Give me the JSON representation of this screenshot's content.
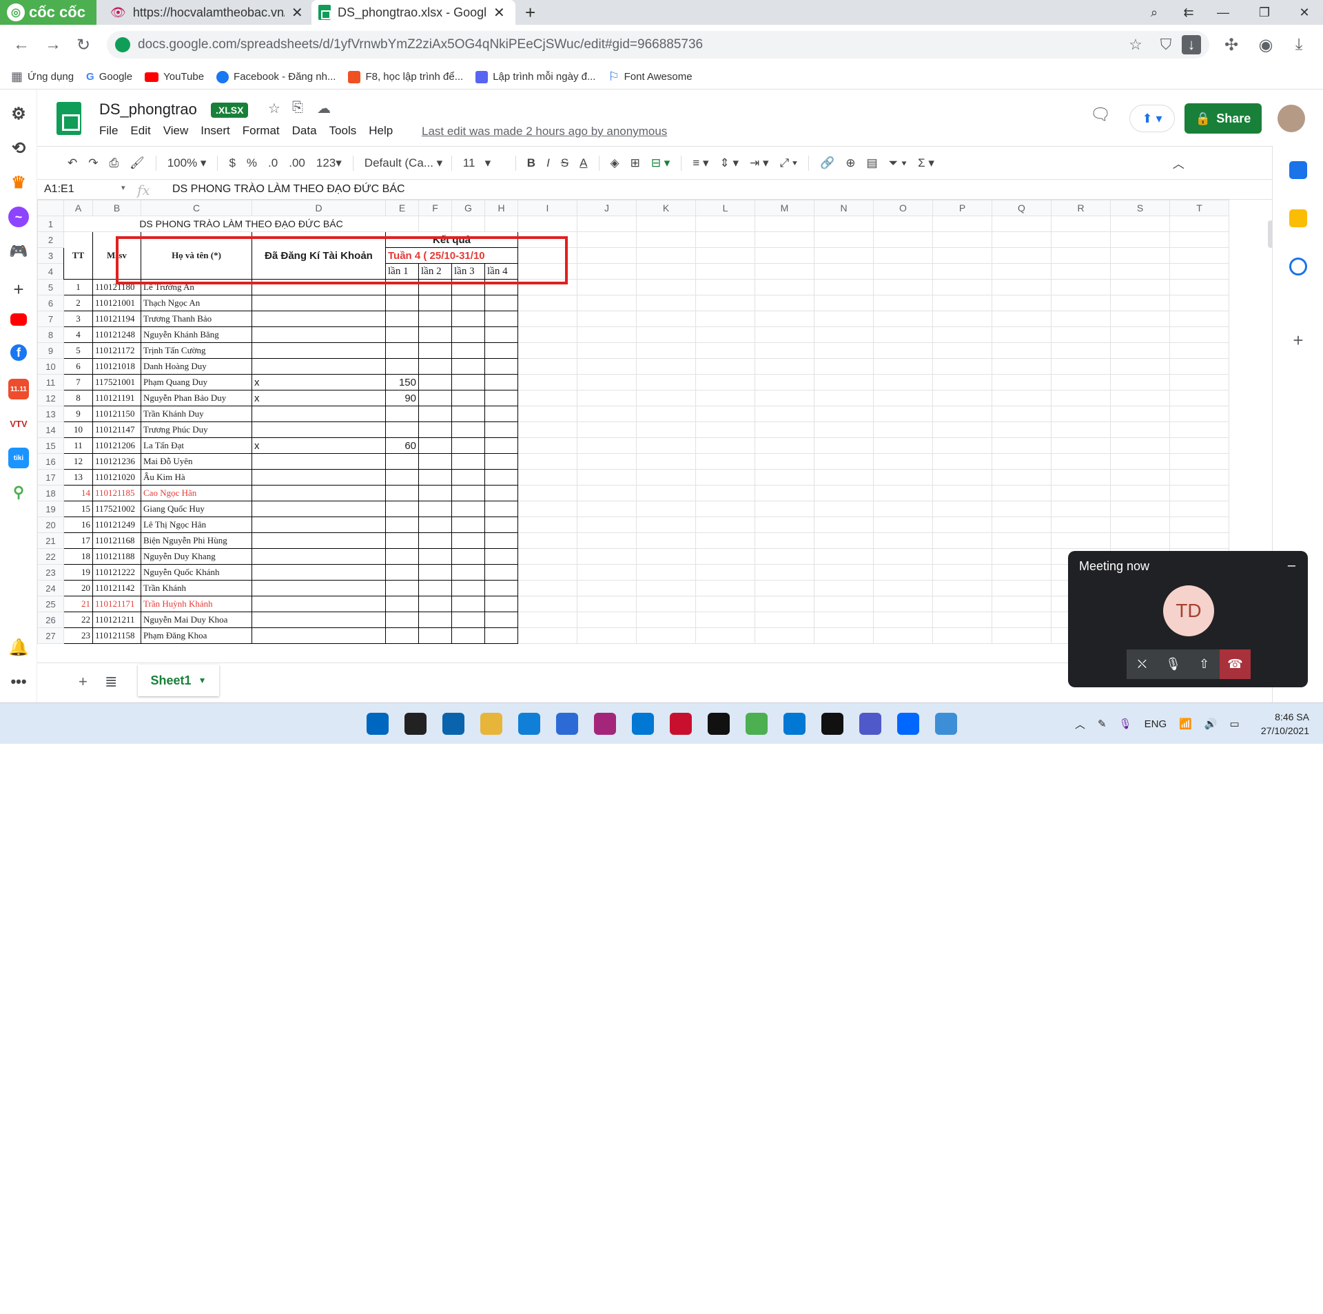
{
  "browser": {
    "brand": "cốc cốc",
    "tabs": [
      {
        "title": "https://hocvalamtheobac.vn/"
      },
      {
        "title": "DS_phongtrao.xlsx - Google S"
      }
    ],
    "url": "docs.google.com/spreadsheets/d/1yfVrnwbYmZ2ziAx5OG4qNkiPEeCjSWuc/edit#gid=966885736",
    "bookmarks": [
      "Ứng dụng",
      "Google",
      "YouTube",
      "Facebook - Đăng nh...",
      "F8, học lập trình để...",
      "Lập trình mỗi ngày đ...",
      "Font Awesome"
    ],
    "bookmark_colors": [
      "#5f6368",
      "#4285f4",
      "#ff0000",
      "#1877f2",
      "#f05123",
      "#5865f2",
      "#1a73e8"
    ]
  },
  "doc": {
    "title": "DS_phongtrao",
    "badge": ".XLSX",
    "menu": [
      "File",
      "Edit",
      "View",
      "Insert",
      "Format",
      "Data",
      "Tools",
      "Help"
    ],
    "last_edit": "Last edit was made 2 hours ago by anonymous",
    "share_label": "Share"
  },
  "toolbar": {
    "zoom": "100%",
    "currency": "$",
    "percent": "%",
    "dec_less": ".0",
    "dec_more": ".00",
    "format_more": "123",
    "font": "Default (Ca...",
    "font_size": "11"
  },
  "formula": {
    "namebox": "A1:E1",
    "fx": "fx",
    "value": "DS PHONG TRÀO LÀM THEO ĐẠO ĐỨC BÁC"
  },
  "sheet": {
    "columns": [
      "A",
      "B",
      "C",
      "D",
      "E",
      "F",
      "G",
      "H",
      "I",
      "J",
      "K",
      "L",
      "M",
      "N",
      "O",
      "P",
      "Q",
      "R",
      "S",
      "T"
    ],
    "row_numbers": [
      "1",
      "2",
      "3",
      "4",
      "5",
      "6",
      "7",
      "8",
      "9",
      "10",
      "11",
      "12",
      "13",
      "14",
      "15",
      "16",
      "17",
      "18",
      "19",
      "20",
      "21",
      "22",
      "23",
      "24",
      "25",
      "26",
      "27"
    ],
    "title": "DS PHONG TRÀO LÀM THEO ĐẠO ĐỨC BÁC",
    "header": {
      "tt": "TT",
      "mssv": "Mssv",
      "name": "Họ và tên (*)",
      "registered": "Đã Đăng Kí Tài Khoản",
      "result": "Kết quả",
      "week": "Tuần 4 ( 25/10-31/10",
      "attempts": [
        "lần 1",
        "lần 2",
        "lần 3",
        "lần 4"
      ]
    },
    "rows": [
      {
        "tt": "1",
        "mssv": "110121180",
        "name": "Lê Trường An",
        "reg": "",
        "l1": ""
      },
      {
        "tt": "2",
        "mssv": "110121001",
        "name": "Thạch Ngọc An",
        "reg": "",
        "l1": ""
      },
      {
        "tt": "3",
        "mssv": "110121194",
        "name": "Trương Thanh Bảo",
        "reg": "",
        "l1": ""
      },
      {
        "tt": "4",
        "mssv": "110121248",
        "name": "Nguyễn Khánh Băng",
        "reg": "",
        "l1": ""
      },
      {
        "tt": "5",
        "mssv": "110121172",
        "name": "Trịnh Tấn Cường",
        "reg": "",
        "l1": ""
      },
      {
        "tt": "6",
        "mssv": "110121018",
        "name": "Danh Hoàng Duy",
        "reg": "",
        "l1": ""
      },
      {
        "tt": "7",
        "mssv": "117521001",
        "name": "Phạm Quang Duy",
        "reg": "x",
        "l1": "150"
      },
      {
        "tt": "8",
        "mssv": "110121191",
        "name": "Nguyễn Phan Bảo Duy",
        "reg": "x",
        "l1": "90"
      },
      {
        "tt": "9",
        "mssv": "110121150",
        "name": "Trần Khánh Duy",
        "reg": "",
        "l1": ""
      },
      {
        "tt": "10",
        "mssv": "110121147",
        "name": "Trương Phúc Duy",
        "reg": "",
        "l1": ""
      },
      {
        "tt": "11",
        "mssv": "110121206",
        "name": "La Tấn Đạt",
        "reg": "x",
        "l1": "60"
      },
      {
        "tt": "12",
        "mssv": "110121236",
        "name": "Mai Đỗ Uyên",
        "reg": "",
        "l1": ""
      },
      {
        "tt": "13",
        "mssv": "110121020",
        "name": "Âu Kim Hà",
        "reg": "",
        "l1": ""
      },
      {
        "tt": "14",
        "mssv": "110121185",
        "name": "Cao Ngọc Hân",
        "reg": "",
        "l1": "",
        "red": true
      },
      {
        "tt": "15",
        "mssv": "117521002",
        "name": "Giang Quốc Huy",
        "reg": "",
        "l1": ""
      },
      {
        "tt": "16",
        "mssv": "110121249",
        "name": "Lê Thị Ngọc Hân",
        "reg": "",
        "l1": ""
      },
      {
        "tt": "17",
        "mssv": "110121168",
        "name": "Biện Nguyễn Phi Hùng",
        "reg": "",
        "l1": ""
      },
      {
        "tt": "18",
        "mssv": "110121188",
        "name": "Nguyễn Duy Khang",
        "reg": "",
        "l1": ""
      },
      {
        "tt": "19",
        "mssv": "110121222",
        "name": "Nguyễn Quốc Khánh",
        "reg": "",
        "l1": ""
      },
      {
        "tt": "20",
        "mssv": "110121142",
        "name": "Trần Khánh",
        "reg": "",
        "l1": ""
      },
      {
        "tt": "21",
        "mssv": "110121171",
        "name": "Trần Huỳnh Khánh",
        "reg": "",
        "l1": "",
        "red": true
      },
      {
        "tt": "22",
        "mssv": "110121211",
        "name": "Nguyễn Mai Duy Khoa",
        "reg": "",
        "l1": ""
      },
      {
        "tt": "23",
        "mssv": "110121158",
        "name": "Phạm Đăng Khoa",
        "reg": "",
        "l1": ""
      }
    ],
    "tab_name": "Sheet1"
  },
  "meeting": {
    "title": "Meeting now",
    "initials": "TD"
  },
  "taskbar": {
    "language": "ENG",
    "time": "8:46 SA",
    "date": "27/10/2021",
    "app_colors": [
      "#0067c0",
      "#222",
      "#0a64ad",
      "#e8b53b",
      "#0f7fd8",
      "#2c6bd6",
      "#a4267b",
      "#0078d4",
      "#c8102e",
      "#111",
      "#4caf50",
      "#0078d4",
      "#111",
      "#5059c9",
      "#0068ff",
      "#3c8fd6"
    ]
  }
}
